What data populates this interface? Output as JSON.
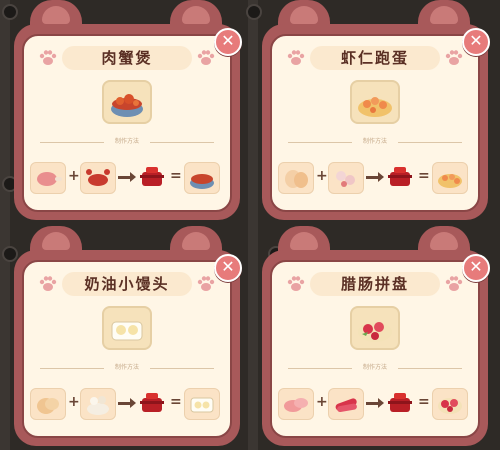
{
  "colors": {
    "frame": "#a8595a",
    "panel": "#fff6e6",
    "close": "#e77b7b",
    "title_text": "#5a2f24"
  },
  "close_glyph": "✕",
  "cards": [
    {
      "title": "肉蟹煲",
      "method_label": "制作方法",
      "ingredient_icons": [
        "meat-icon",
        "crab-icon"
      ],
      "tool_icon": "cooking-pot-icon",
      "result_icon": "crab-hotpot-icon"
    },
    {
      "title": "虾仁跑蛋",
      "method_label": "制作方法",
      "ingredient_icons": [
        "egg-icon",
        "shrimp-icon"
      ],
      "tool_icon": "cooking-pot-icon",
      "result_icon": "shrimp-omelette-icon"
    },
    {
      "title": "奶油小馒头",
      "method_label": "制作方法",
      "ingredient_icons": [
        "dough-icon",
        "flour-icon"
      ],
      "tool_icon": "cooking-pot-icon",
      "result_icon": "cream-buns-icon"
    },
    {
      "title": "腊肠拼盘",
      "method_label": "制作方法",
      "ingredient_icons": [
        "pink-meat-icon",
        "sausage-icon"
      ],
      "tool_icon": "cooking-pot-icon",
      "result_icon": "sausage-platter-icon"
    }
  ]
}
